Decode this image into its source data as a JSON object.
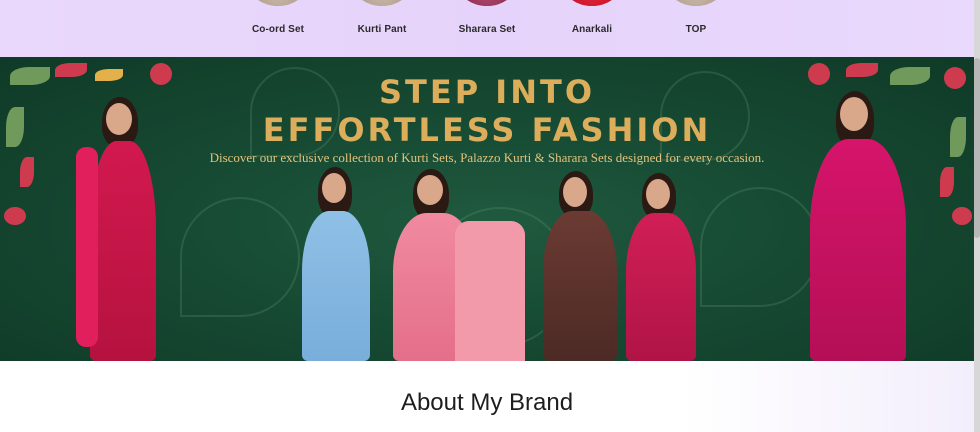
{
  "categories": [
    {
      "label": "Co-ord Set",
      "icon": "co-ord-set-thumbnail"
    },
    {
      "label": "Kurti Pant",
      "icon": "kurti-pant-thumbnail"
    },
    {
      "label": "Sharara Set",
      "icon": "sharara-set-thumbnail"
    },
    {
      "label": "Anarkali",
      "icon": "anarkali-thumbnail"
    },
    {
      "label": "TOP",
      "icon": "top-thumbnail"
    }
  ],
  "banner": {
    "headline_line1": "STEP INTO",
    "headline_line2": "EFFORTLESS FASHION",
    "tagline": "Discover our exclusive collection of Kurti Sets, Palazzo Kurti & Sharara Sets designed for every occasion.",
    "colors": {
      "background": "#174a33",
      "headline": "#dcae5b",
      "tagline": "#e4c27a"
    }
  },
  "about": {
    "title": "About My Brand"
  }
}
